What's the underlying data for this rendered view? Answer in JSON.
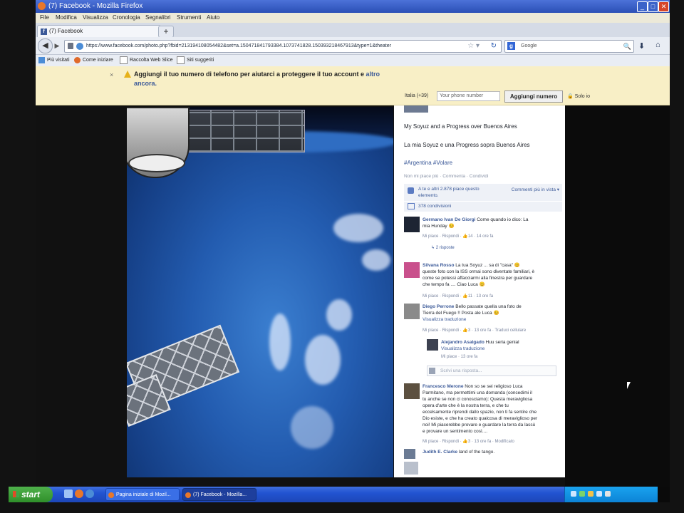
{
  "window": {
    "title": "(7) Facebook - Mozilla Firefox",
    "buttons": {
      "minimize": "_",
      "maximize": "□",
      "close": "✕"
    }
  },
  "menu": [
    "File",
    "Modifica",
    "Visualizza",
    "Cronologia",
    "Segnalibri",
    "Strumenti",
    "Aiuto"
  ],
  "tabs": [
    {
      "label": "(7) Facebook"
    }
  ],
  "newtab_label": "+",
  "nav": {
    "url": "https://www.facebook.com/photo.php?fbid=213194108054482&set=a.150471841793384.1073741828.150393218467913&type=1&theater",
    "search_placeholder": "Google"
  },
  "bookmarks": [
    {
      "label": "Più visitati"
    },
    {
      "label": "Come iniziare"
    },
    {
      "label": "Raccolta Web Slice"
    },
    {
      "label": "Siti suggeriti"
    }
  ],
  "notice": {
    "close": "×",
    "message": "Aggiungi il tuo numero di telefono per aiutarci a proteggere il tuo account e",
    "link": "altro",
    "message_end": "ancora.",
    "country": "Italia (+39)",
    "phone_placeholder": "Your phone number",
    "add_button": "Aggiungi numero",
    "only_you": "Solo io"
  },
  "post": {
    "caption_en": "My Soyuz and a Progress over Buenos Aires",
    "caption_it": "La mia Soyuz e una Progress sopra Buenos Aires",
    "hashtags": "#Argentina #Volare",
    "actions": "Non mi piace più · Commenta · Condividi",
    "likes_text": "A te e altri 2.878 piace questo elemento.",
    "comments_view": "Commenti più in vista ▾",
    "shares": "378 condivisioni"
  },
  "comments": [
    {
      "name": "Germano Ivan De Giorgi",
      "text": [
        "Come quando io dico: La",
        "mia Hunday 😊"
      ],
      "meta": "Mi piace · Rispondi · 👍14 · 14 ore fa",
      "replies": "2 risposte"
    },
    {
      "name": "Silvana Rosso",
      "text": [
        "La tua Soyuz ... sa di \"casa\" 😊",
        "queste foto con la ISS ormai sono diventate familiari, è",
        "come se potessi affacciarmi alla finestra per guardare",
        "che tempo fa .... Ciao Luca 😊"
      ],
      "meta": "Mi piace · Rispondi · 👍11 · 13 ore fa"
    },
    {
      "name": "Diego Perrone",
      "text": [
        "Bello passate quella una foto de",
        "Tierra del Fuego !! Posta ale Luca 😊",
        "Visualizza traduzione"
      ],
      "meta": "Mi piace · Rispondi · 👍3 · 13 ore fa · Traduci cellulare"
    },
    {
      "name": "Alejandro Asalgado",
      "text": [
        "Huu seria genial",
        "Visualizza traduzione"
      ],
      "meta": "Mi piace · 13 ore fa"
    },
    {
      "name": "Francesco Merone",
      "text": [
        "Non so se sei religioso Luca",
        "Parmitano, ma permettimi una domanda (concedimi il",
        "tu anche se non ci conosciamo): Questa meravigliosa",
        "opera d'arte che è la nostra terra, e che tu",
        "eccelsamente riprendi dallo spazio, non ti fa sentire che",
        "Dio esiste, e che ha creato qualcosa di meraviglioso per",
        "noi! Mi piacerebbe provare e guardare la terra da lassù",
        "e provare un sentimento così...."
      ],
      "meta": "Mi piace · Rispondi · 👍3 · 13 ore fa · Modificato"
    },
    {
      "name": "Judith E. Clarke",
      "text": [
        "land of the tango."
      ],
      "meta": ""
    }
  ],
  "reply_placeholder": "Scrivi una risposta...",
  "taskbar": {
    "start": "start",
    "items": [
      "Pagina iniziale di Mozil...",
      "(7) Facebook - Mozilla..."
    ]
  }
}
